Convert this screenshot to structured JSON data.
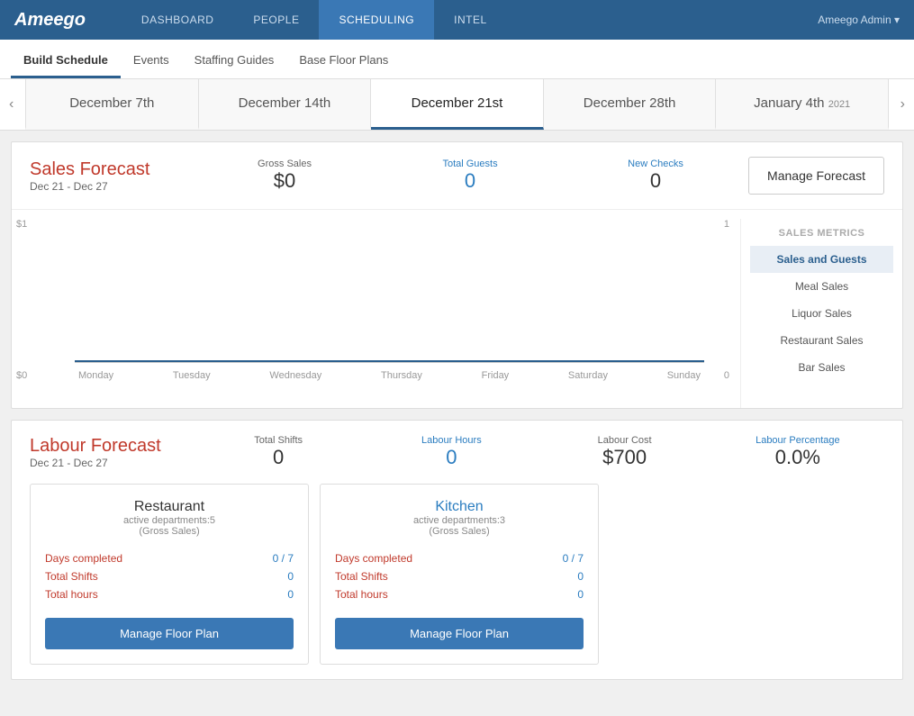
{
  "app": {
    "logo": "Ameego",
    "nav_links": [
      {
        "label": "Dashboard",
        "href": "#",
        "active": false
      },
      {
        "label": "People",
        "href": "#",
        "active": false
      },
      {
        "label": "Scheduling",
        "href": "#",
        "active": true
      },
      {
        "label": "Intel",
        "href": "#",
        "active": false
      }
    ],
    "user": "Ameego Admin ▾"
  },
  "sub_nav": {
    "items": [
      {
        "label": "Build Schedule",
        "active": true
      },
      {
        "label": "Events",
        "active": false
      },
      {
        "label": "Staffing Guides",
        "active": false
      },
      {
        "label": "Base Floor Plans",
        "active": false
      }
    ]
  },
  "week_tabs": {
    "prev_arrow": "‹",
    "next_arrow": "›",
    "tabs": [
      {
        "label": "December 7th",
        "active": false
      },
      {
        "label": "December 14th",
        "active": false
      },
      {
        "label": "December 21st",
        "active": true
      },
      {
        "label": "December 28th",
        "active": false
      },
      {
        "label": "January 4th",
        "suffix": "2021",
        "active": false
      }
    ]
  },
  "sales_forecast": {
    "title": "Sales Forecast",
    "date_range": "Dec 21 - Dec 27",
    "gross_sales_label": "Gross Sales",
    "gross_sales_value": "$0",
    "total_guests_label": "Total Guests",
    "total_guests_value": "0",
    "new_checks_label": "New Checks",
    "new_checks_value": "0",
    "manage_button_label": "Manage Forecast"
  },
  "chart": {
    "y_labels_left": [
      "$1",
      "$0"
    ],
    "y_labels_right": [
      "1",
      "0"
    ],
    "x_labels": [
      "Monday",
      "Tuesday",
      "Wednesday",
      "Thursday",
      "Friday",
      "Saturday",
      "Sunday"
    ],
    "metrics_title": "Sales Metrics",
    "metrics": [
      {
        "label": "Sales and Guests",
        "active": true
      },
      {
        "label": "Meal Sales",
        "active": false
      },
      {
        "label": "Liquor Sales",
        "active": false
      },
      {
        "label": "Restaurant Sales",
        "active": false
      },
      {
        "label": "Bar Sales",
        "active": false
      }
    ]
  },
  "labour_forecast": {
    "title": "Labour Forecast",
    "date_range": "Dec 21 - Dec 27",
    "total_shifts_label": "Total Shifts",
    "total_shifts_value": "0",
    "labour_hours_label": "Labour Hours",
    "labour_hours_value": "0",
    "labour_cost_label": "Labour Cost",
    "labour_cost_value": "$700",
    "labour_pct_label": "Labour Percentage",
    "labour_pct_value": "0.0%"
  },
  "departments": [
    {
      "name": "Restaurant",
      "name_style": "plain",
      "active_depts": "active departments:5",
      "gross": "(Gross Sales)",
      "days_completed_label": "Days completed",
      "days_completed_value": "0 / 7",
      "total_shifts_label": "Total Shifts",
      "total_shifts_value": "0",
      "total_hours_label": "Total hours",
      "total_hours_value": "0",
      "manage_label": "Manage Floor Plan"
    },
    {
      "name": "Kitchen",
      "name_style": "blue",
      "active_depts": "active departments:3",
      "gross": "(Gross Sales)",
      "days_completed_label": "Days completed",
      "days_completed_value": "0 / 7",
      "total_shifts_label": "Total Shifts",
      "total_shifts_value": "0",
      "total_hours_label": "Total hours",
      "total_hours_value": "0",
      "manage_label": "Manage Floor Plan"
    }
  ]
}
